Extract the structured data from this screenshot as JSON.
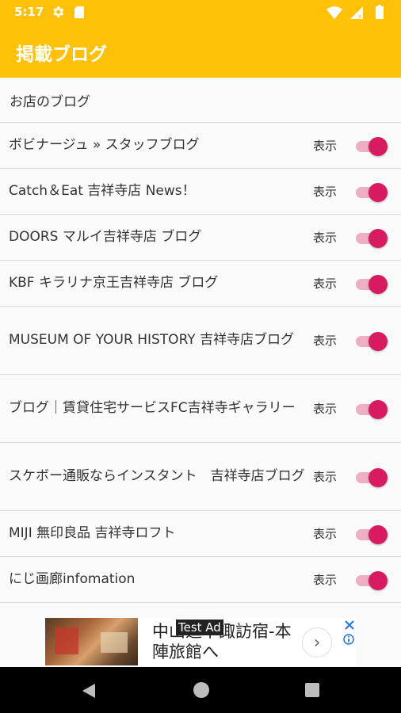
{
  "status_bar": {
    "time": "5:17"
  },
  "app_bar": {
    "title": "掲載ブログ"
  },
  "section": {
    "header": "お店のブログ"
  },
  "blogs": [
    {
      "title": "ボビナージュ » スタッフブログ",
      "label": "表示",
      "enabled": true
    },
    {
      "title": "Catch＆Eat 吉祥寺店 News！",
      "label": "表示",
      "enabled": true
    },
    {
      "title": "DOORS マルイ吉祥寺店 ブログ",
      "label": "表示",
      "enabled": true
    },
    {
      "title": "KBF キラリナ京王吉祥寺店 ブログ",
      "label": "表示",
      "enabled": true
    },
    {
      "title": "MUSEUM OF YOUR HISTORY 吉祥寺店ブログ",
      "label": "表示",
      "enabled": true
    },
    {
      "title": "ブログ｜賃貸住宅サービスFC吉祥寺ギャラリー",
      "label": "表示",
      "enabled": true
    },
    {
      "title": "スケボー通販ならインスタント　吉祥寺店ブログ",
      "label": "表示",
      "enabled": true
    },
    {
      "title": "MIJI 無印良品 吉祥寺ロフト",
      "label": "表示",
      "enabled": true
    },
    {
      "title": "にじ画廊infomation",
      "label": "表示",
      "enabled": true
    }
  ],
  "ad": {
    "label": "Test Ad",
    "text": "中山道下諏訪宿-本陣旅館へ",
    "arrow": "›"
  },
  "colors": {
    "accent": "#ffc107",
    "toggle_thumb": "#d81b60",
    "toggle_track": "#eeaec3"
  }
}
